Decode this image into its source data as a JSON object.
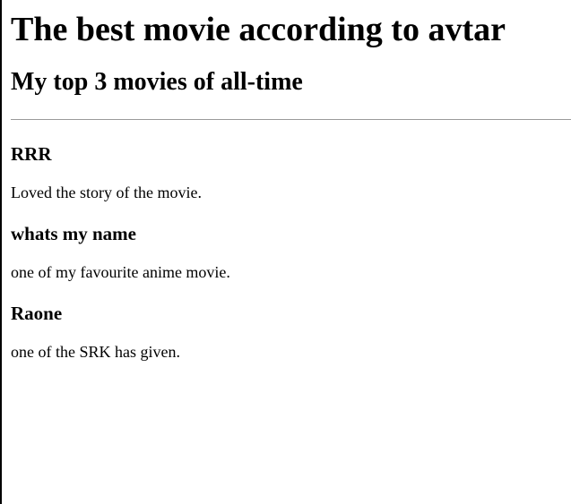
{
  "page": {
    "title": "The best movie according to avtar",
    "subtitle": "My top 3 movies of all-time"
  },
  "movies": [
    {
      "title": "RRR",
      "description": "Loved the story of the movie."
    },
    {
      "title": "whats my name",
      "description": "one of my favourite anime movie."
    },
    {
      "title": "Raone",
      "description": "one of the SRK has given."
    }
  ]
}
